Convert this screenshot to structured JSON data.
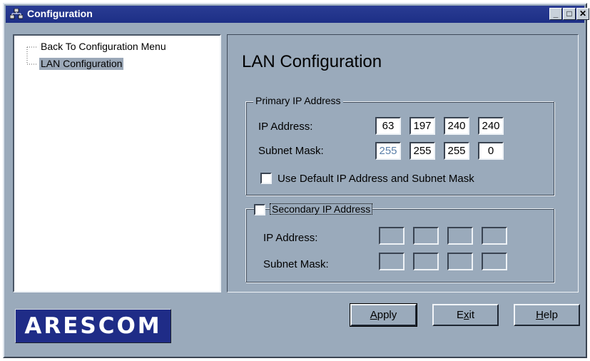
{
  "window": {
    "title": "Configuration",
    "controls": {
      "minimize": "_",
      "maximize": "□",
      "close": "✕"
    },
    "icon": "network-computers-icon"
  },
  "tree": {
    "items": [
      {
        "label": "Back To Configuration Menu",
        "selected": false
      },
      {
        "label": "LAN Configuration",
        "selected": true
      }
    ]
  },
  "panel": {
    "title": "LAN Configuration",
    "primary": {
      "legend": "Primary IP Address",
      "ip_label": "IP Address:",
      "ip": [
        "63",
        "197",
        "240",
        "240"
      ],
      "mask_label": "Subnet Mask:",
      "mask": [
        "255",
        "255",
        "255",
        "0"
      ],
      "default_checkbox_label": "Use Default IP Address and Subnet Mask",
      "default_checked": false
    },
    "secondary": {
      "legend": "Secondary IP Address",
      "enabled": false,
      "ip_label": "IP Address:",
      "ip": [
        "",
        "",
        "",
        ""
      ],
      "mask_label": "Subnet Mask:",
      "mask": [
        "",
        "",
        "",
        ""
      ]
    }
  },
  "buttons": {
    "apply": {
      "label": "Apply",
      "mnemonic": "A"
    },
    "exit": {
      "label": "Exit",
      "mnemonic": "x"
    },
    "help": {
      "label": "Help",
      "mnemonic": "H"
    }
  },
  "branding": {
    "logo_text": "ARESCOM"
  },
  "colors": {
    "titlebar": "#1d2f86",
    "window_bg": "#9aaabb",
    "selection": "#9ba8b8",
    "logo_bg": "#1f2c87"
  }
}
